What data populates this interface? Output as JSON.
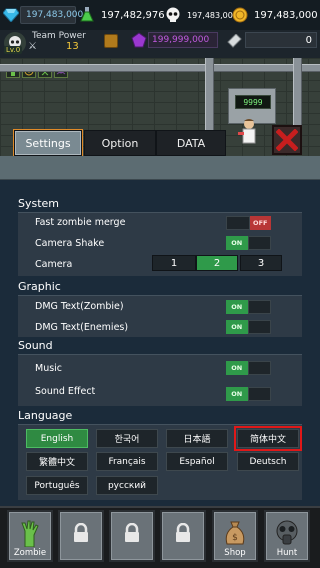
{
  "colors": {
    "accent_green": "#2f9a4a",
    "toggle_off_red": "#b83636",
    "highlight_red": "#e01818",
    "gold": "#f3c83a",
    "gem_purple": "#c25ae0"
  },
  "currency": {
    "diamond": "197,483,000",
    "potion": "197,482,976",
    "skull": "197,483,000",
    "coin": "197,483,000"
  },
  "player": {
    "level": "Lv.0",
    "team_power_label": "Team Power",
    "team_power_value": "13",
    "gems": "199,999,000",
    "tickets": "0"
  },
  "scene": {
    "machine_counter": "9999"
  },
  "tabs": [
    {
      "label": "Settings",
      "active": true
    },
    {
      "label": "Option",
      "active": false
    },
    {
      "label": "DATA",
      "active": false
    }
  ],
  "system": {
    "title": "System",
    "fast_zombie_merge": {
      "label": "Fast zombie merge",
      "state": "OFF"
    },
    "camera_shake": {
      "label": "Camera Shake",
      "state": "ON"
    },
    "camera": {
      "label": "Camera",
      "options": [
        "1",
        "2",
        "3"
      ],
      "selected": "2"
    }
  },
  "graphic": {
    "title": "Graphic",
    "dmg_zombie": {
      "label": "DMG Text(Zombie)",
      "state": "ON"
    },
    "dmg_enemies": {
      "label": "DMG Text(Enemies)",
      "state": "ON"
    }
  },
  "sound": {
    "title": "Sound",
    "music": {
      "label": "Music",
      "state": "ON"
    },
    "sound_effect": {
      "label": "Sound Effect",
      "state": "ON"
    }
  },
  "language": {
    "title": "Language",
    "options": [
      "English",
      "한국어",
      "日本語",
      "简体中文",
      "繁體中文",
      "Français",
      "Español",
      "Deutsch",
      "Português",
      "русский"
    ],
    "selected": "English",
    "highlighted": "简体中文"
  },
  "bottom_nav": {
    "zombie": "Zombie",
    "shop": "Shop",
    "hunt": "Hunt"
  }
}
